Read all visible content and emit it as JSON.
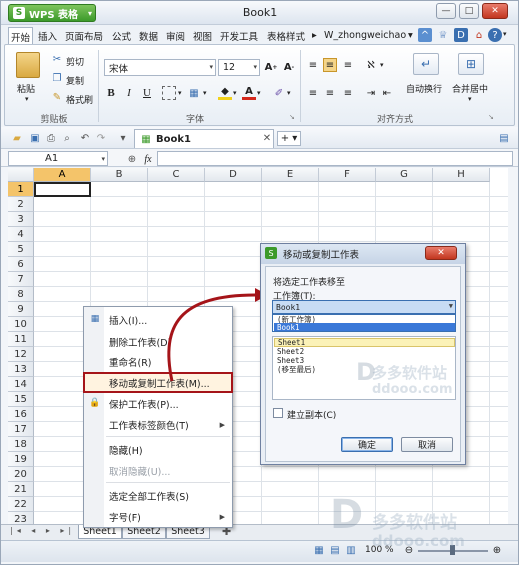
{
  "app": {
    "wps_button_label": "WPS 表格",
    "wps_logo": "S",
    "doc_title": "Book1"
  },
  "menu": {
    "tabs": [
      "开始",
      "插入",
      "页面布局",
      "公式",
      "数据",
      "审阅",
      "视图",
      "开发工具",
      "表格样式"
    ],
    "user": "W_zhongweichao"
  },
  "ribbon": {
    "paste_label": "粘贴",
    "cut_label": "剪切",
    "copy_label": "复制",
    "format_painter_label": "格式刷",
    "clipboard_group": "剪贴板",
    "font_name": "宋体",
    "font_size": "12",
    "font_group": "字体",
    "bold": "B",
    "italic": "I",
    "underline": "U",
    "wrap_label": "自动换行",
    "merge_label": "合并居中",
    "align_group": "对齐方式"
  },
  "quickbar": {
    "doc_tab": "Book1"
  },
  "formula_bar": {
    "cell_ref": "A1",
    "fx": "fx"
  },
  "grid": {
    "columns": [
      "A",
      "B",
      "C",
      "D",
      "E",
      "F",
      "G",
      "H"
    ],
    "rows": [
      "1",
      "2",
      "3",
      "4",
      "5",
      "6",
      "7",
      "8",
      "9",
      "10",
      "11",
      "12",
      "13",
      "14",
      "15",
      "16",
      "17",
      "18",
      "19",
      "20",
      "21",
      "22",
      "23"
    ]
  },
  "sheets": [
    "Sheet1",
    "Sheet2",
    "Sheet3"
  ],
  "context_menu": {
    "items": [
      {
        "label": "插入(I)...",
        "disabled": false
      },
      {
        "label": "删除工作表(D)",
        "disabled": false
      },
      {
        "label": "重命名(R)",
        "disabled": false
      },
      {
        "label": "移动或复制工作表(M)...",
        "disabled": false
      },
      {
        "label": "保护工作表(P)...",
        "disabled": false
      },
      {
        "label": "工作表标签颜色(T)",
        "disabled": false
      },
      {
        "label": "隐藏(H)",
        "disabled": false
      },
      {
        "label": "取消隐藏(U)...",
        "disabled": true
      },
      {
        "label": "选定全部工作表(S)",
        "disabled": false
      },
      {
        "label": "字号(F)",
        "disabled": false
      }
    ]
  },
  "dialog": {
    "title": "移动或复制工作表",
    "move_to_label": "将选定工作表移至",
    "workbook_label": "工作簿(T):",
    "workbook_value": "Book1",
    "dropdown_options": [
      "(新工作簿)",
      "Book1"
    ],
    "before_sheet_options": [
      "Sheet1",
      "Sheet2",
      "Sheet3",
      "(移至最后)"
    ],
    "copy_checkbox_label": "建立副本(C)",
    "ok_label": "确定",
    "cancel_label": "取消"
  },
  "status": {
    "zoom": "100 %"
  },
  "watermark": {
    "brand": "多多软件站",
    "url": "ddooo.com",
    "url2": "ddooo.com"
  },
  "colors": {
    "highlight_border": "#a51419",
    "arrow": "#a51419",
    "selected_header": "#f4c46a"
  }
}
